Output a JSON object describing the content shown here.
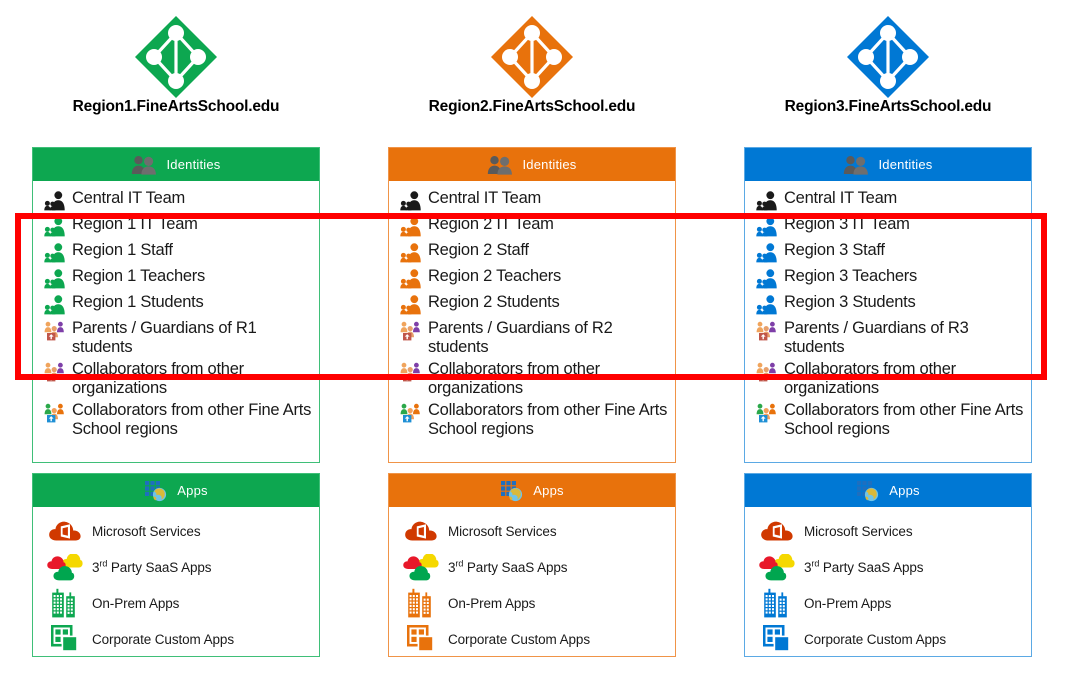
{
  "diagram": {
    "title": "Fine Arts School multi-region tenant identities and apps",
    "highlight_color": "#FF0000"
  },
  "columns": [
    {
      "tenant_name": "Region1.FineArtsSchool.edu",
      "accent_color": "#0DA750",
      "border_color": "#3FBF78",
      "logo_icon": "azure-active-directory-icon",
      "identities": {
        "header_label": "Identities",
        "header_icon": "people-icon",
        "items": [
          {
            "label": "Central IT Team",
            "icon": "users-group-icon",
            "icon_variant": "black",
            "highlighted": false
          },
          {
            "label": "Region 1 IT Team",
            "icon": "users-group-icon",
            "icon_variant": "accent",
            "highlighted": true
          },
          {
            "label": "Region 1 Staff",
            "icon": "users-group-icon",
            "icon_variant": "accent",
            "highlighted": true
          },
          {
            "label": "Region 1 Teachers",
            "icon": "users-group-icon",
            "icon_variant": "accent",
            "highlighted": true
          },
          {
            "label": "Region 1 Students",
            "icon": "users-group-icon",
            "icon_variant": "accent",
            "highlighted": true
          },
          {
            "label": "Parents / Guardians of R1 students",
            "icon": "external-users-icon",
            "icon_variant": "mixed-warm",
            "highlighted": true
          },
          {
            "label": "Collaborators from other organizations",
            "icon": "external-users-icon",
            "icon_variant": "mixed-warm",
            "highlighted": false
          },
          {
            "label": "Collaborators from other Fine Arts School regions",
            "icon": "external-users-icon",
            "icon_variant": "mixed-cool",
            "highlighted": false
          }
        ]
      },
      "apps": {
        "header_label": "Apps",
        "header_icon": "apps-globe-icon",
        "items": [
          {
            "label": "Microsoft Services",
            "label_sup": "",
            "icon": "office-cloud-icon"
          },
          {
            "label": "Party SaaS Apps",
            "label_prefix": "3",
            "label_sup": "rd",
            "icon": "saas-clouds-icon"
          },
          {
            "label": "On-Prem Apps",
            "label_sup": "",
            "icon": "buildings-icon"
          },
          {
            "label": "Corporate Custom Apps",
            "label_sup": "",
            "icon": "custom-apps-icon"
          }
        ]
      }
    },
    {
      "tenant_name": "Region2.FineArtsSchool.edu",
      "accent_color": "#E8720C",
      "border_color": "#F09448",
      "logo_icon": "azure-active-directory-icon",
      "identities": {
        "header_label": "Identities",
        "header_icon": "people-icon",
        "items": [
          {
            "label": "Central IT Team",
            "icon": "users-group-icon",
            "icon_variant": "black",
            "highlighted": false
          },
          {
            "label": "Region 2 IT Team",
            "icon": "users-group-icon",
            "icon_variant": "accent",
            "highlighted": true
          },
          {
            "label": "Region 2 Staff",
            "icon": "users-group-icon",
            "icon_variant": "accent",
            "highlighted": true
          },
          {
            "label": "Region 2 Teachers",
            "icon": "users-group-icon",
            "icon_variant": "accent",
            "highlighted": true
          },
          {
            "label": "Region 2 Students",
            "icon": "users-group-icon",
            "icon_variant": "accent",
            "highlighted": true
          },
          {
            "label": "Parents / Guardians of R2 students",
            "icon": "external-users-icon",
            "icon_variant": "mixed-warm",
            "highlighted": true
          },
          {
            "label": "Collaborators from other organizations",
            "icon": "external-users-icon",
            "icon_variant": "mixed-warm",
            "highlighted": false
          },
          {
            "label": "Collaborators from other Fine Arts School regions",
            "icon": "external-users-icon",
            "icon_variant": "mixed-cool",
            "highlighted": false
          }
        ]
      },
      "apps": {
        "header_label": "Apps",
        "header_icon": "apps-globe-icon",
        "items": [
          {
            "label": "Microsoft Services",
            "label_sup": "",
            "icon": "office-cloud-icon"
          },
          {
            "label": "Party SaaS Apps",
            "label_prefix": "3",
            "label_sup": "rd",
            "icon": "saas-clouds-icon"
          },
          {
            "label": "On-Prem Apps",
            "label_sup": "",
            "icon": "buildings-icon"
          },
          {
            "label": "Corporate Custom Apps",
            "label_sup": "",
            "icon": "custom-apps-icon"
          }
        ]
      }
    },
    {
      "tenant_name": "Region3.FineArtsSchool.edu",
      "accent_color": "#0078D4",
      "border_color": "#5BA9E4",
      "logo_icon": "azure-active-directory-icon",
      "identities": {
        "header_label": "Identities",
        "header_icon": "people-icon",
        "items": [
          {
            "label": "Central IT Team",
            "icon": "users-group-icon",
            "icon_variant": "black",
            "highlighted": false
          },
          {
            "label": "Region 3 IT Team",
            "icon": "users-group-icon",
            "icon_variant": "accent",
            "highlighted": true
          },
          {
            "label": "Region 3 Staff",
            "icon": "users-group-icon",
            "icon_variant": "accent",
            "highlighted": true
          },
          {
            "label": "Region 3 Teachers",
            "icon": "users-group-icon",
            "icon_variant": "accent",
            "highlighted": true
          },
          {
            "label": "Region 3 Students",
            "icon": "users-group-icon",
            "icon_variant": "accent",
            "highlighted": true
          },
          {
            "label": "Parents / Guardians of R3 students",
            "icon": "external-users-icon",
            "icon_variant": "mixed-warm",
            "highlighted": true
          },
          {
            "label": "Collaborators from other organizations",
            "icon": "external-users-icon",
            "icon_variant": "mixed-warm",
            "highlighted": false
          },
          {
            "label": "Collaborators from other Fine Arts School regions",
            "icon": "external-users-icon",
            "icon_variant": "mixed-cool",
            "highlighted": false
          }
        ]
      },
      "apps": {
        "header_label": "Apps",
        "header_icon": "apps-globe-icon",
        "items": [
          {
            "label": "Microsoft Services",
            "label_sup": "",
            "icon": "office-cloud-icon"
          },
          {
            "label": "Party SaaS Apps",
            "label_prefix": "3",
            "label_sup": "rd",
            "icon": "saas-clouds-icon"
          },
          {
            "label": "On-Prem Apps",
            "label_sup": "",
            "icon": "buildings-icon"
          },
          {
            "label": "Corporate Custom Apps",
            "label_sup": "",
            "icon": "custom-apps-icon"
          }
        ]
      }
    }
  ]
}
